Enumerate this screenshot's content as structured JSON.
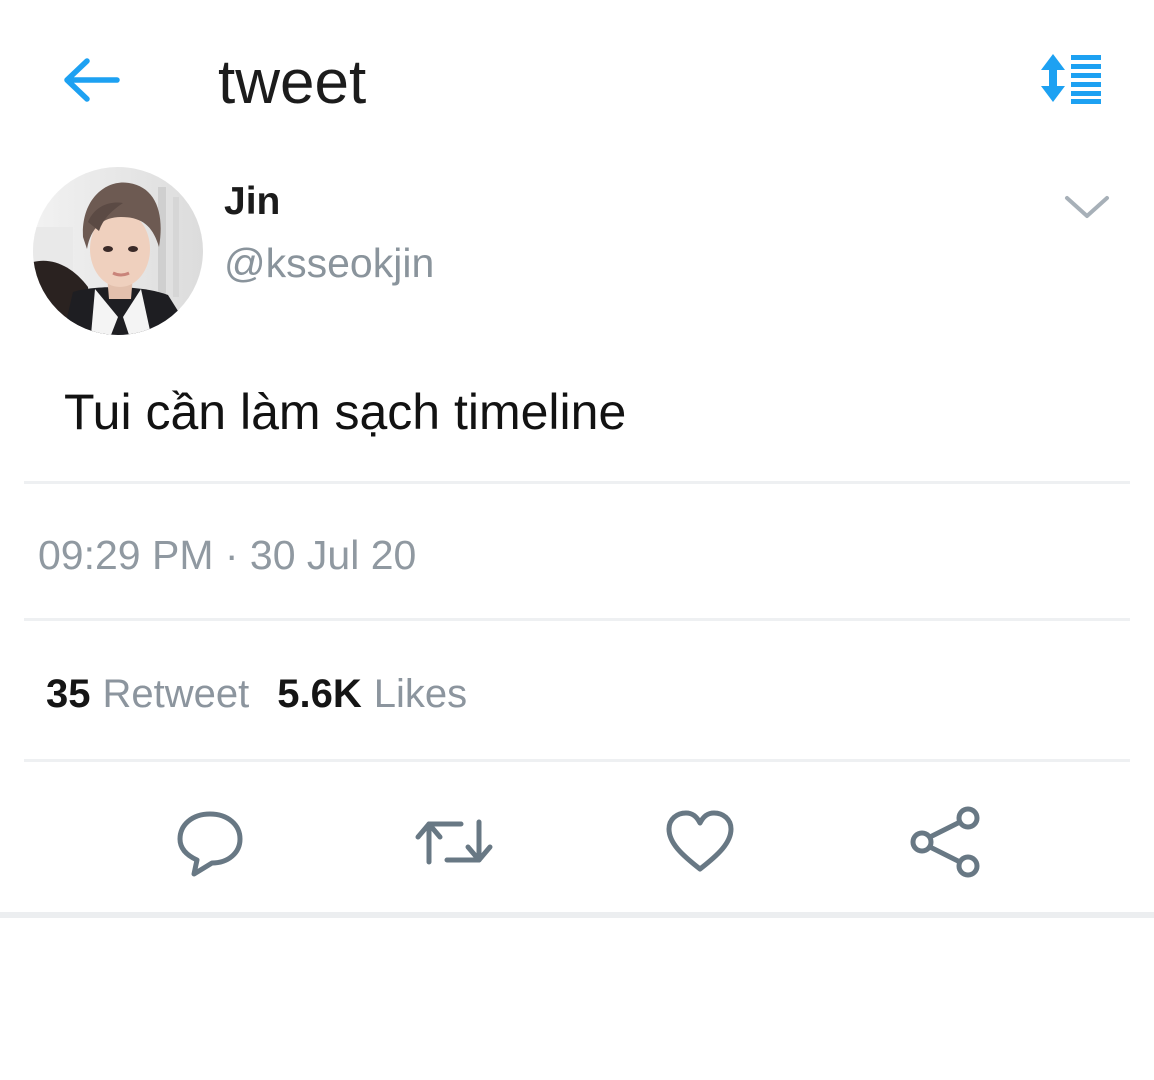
{
  "header": {
    "title": "tweet",
    "back_icon": "arrow-left-icon",
    "sort_icon": "sort-list-icon",
    "accent_color": "#1da1f2"
  },
  "tweet": {
    "author": {
      "display_name": "Jin",
      "handle": "@ksseokjin"
    },
    "text": "Tui cần làm sạch timeline",
    "timestamp": "09:29 PM · 30 Jul 20",
    "stats": {
      "retweets": "35",
      "retweets_label": "Retweet",
      "likes": "5.6K",
      "likes_label": "Likes"
    },
    "actions": [
      {
        "icon": "reply-icon"
      },
      {
        "icon": "retweet-icon"
      },
      {
        "icon": "heart-icon"
      },
      {
        "icon": "share-icon"
      }
    ]
  }
}
